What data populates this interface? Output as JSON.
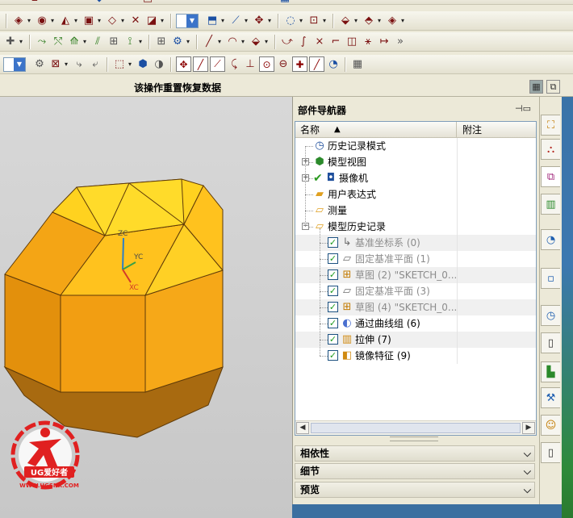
{
  "status_message": "该操作重置恢复数据",
  "navigator": {
    "title": "部件导航器",
    "columns": {
      "name": "名称",
      "note": "附注"
    },
    "rows": [
      {
        "label": "历史记录模式",
        "icon": "clock-icon",
        "indent": 1,
        "expander": "",
        "checkbox": "none",
        "dim": false
      },
      {
        "label": "模型视图",
        "icon": "model-view-icon",
        "indent": 1,
        "expander": "+",
        "checkbox": "none",
        "dim": false
      },
      {
        "label": "摄像机",
        "icon": "camera-icon",
        "indent": 1,
        "expander": "+",
        "checkbox": "check",
        "dim": false
      },
      {
        "label": "用户表达式",
        "icon": "folder-icon",
        "indent": 1,
        "expander": "",
        "checkbox": "none",
        "dim": false
      },
      {
        "label": "测量",
        "icon": "folder-open-icon",
        "indent": 1,
        "expander": "",
        "checkbox": "none",
        "dim": false
      },
      {
        "label": "模型历史记录",
        "icon": "folder-open-icon",
        "indent": 1,
        "expander": "-",
        "checkbox": "none",
        "dim": false
      },
      {
        "label": "基准坐标系 (0)",
        "icon": "datum-csys-icon",
        "indent": 2,
        "expander": "",
        "checkbox": "box",
        "dim": true
      },
      {
        "label": "固定基准平面 (1)",
        "icon": "datum-plane-icon",
        "indent": 2,
        "expander": "",
        "checkbox": "box",
        "dim": true
      },
      {
        "label": "草图 (2) \"SKETCH_0...",
        "icon": "sketch-icon",
        "indent": 2,
        "expander": "",
        "checkbox": "box",
        "dim": true
      },
      {
        "label": "固定基准平面 (3)",
        "icon": "datum-plane-icon",
        "indent": 2,
        "expander": "",
        "checkbox": "box",
        "dim": true
      },
      {
        "label": "草图 (4) \"SKETCH_0...",
        "icon": "sketch-icon",
        "indent": 2,
        "expander": "",
        "checkbox": "box",
        "dim": true
      },
      {
        "label": "通过曲线组 (6)",
        "icon": "through-curves-icon",
        "indent": 2,
        "expander": "",
        "checkbox": "box",
        "dim": false
      },
      {
        "label": "拉伸 (7)",
        "icon": "extrude-icon",
        "indent": 2,
        "expander": "",
        "checkbox": "box",
        "dim": false
      },
      {
        "label": "镜像特征 (9)",
        "icon": "mirror-feature-icon",
        "indent": 2,
        "expander": "",
        "checkbox": "box",
        "dim": false
      }
    ],
    "sections": [
      "相依性",
      "细节",
      "预览"
    ]
  },
  "triad": {
    "zc": "ZC",
    "yc": "YC",
    "xc": "XC"
  },
  "watermark": {
    "brand": "UG爱好者",
    "url": "WWW.UGSNX.COM"
  },
  "colors": {
    "solid_top": "#ffd21f",
    "solid_side": "#f0a010",
    "solid_shadow": "#a86a10",
    "selection_accent": "#3c74c9"
  }
}
